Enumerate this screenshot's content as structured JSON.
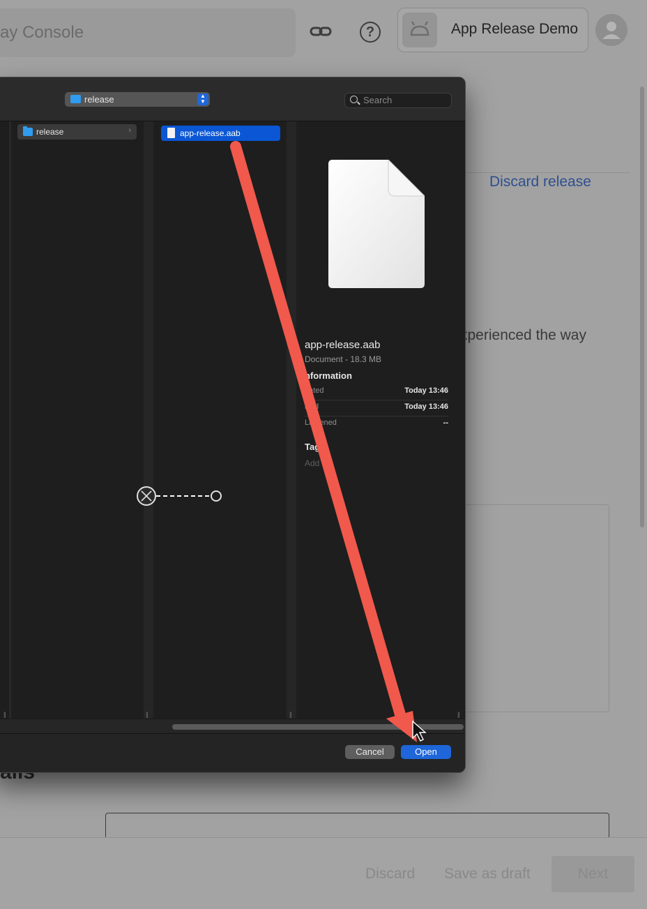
{
  "header": {
    "console_title": "ay Console",
    "app_name": "App Release Demo"
  },
  "page": {
    "discard_release": "Discard release",
    "experience_text": "xperienced the way",
    "details_heading": "ails"
  },
  "bottom_bar": {
    "discard": "Discard",
    "save_draft": "Save as draft",
    "next": "Next"
  },
  "dialog": {
    "path_folder": "release",
    "search_placeholder": "Search",
    "column1_item": "release",
    "column2_item": "app-release.aab",
    "preview": {
      "name": "app-release.aab",
      "kind": "Document - 18.3 MB",
      "information_heading": "nformation",
      "rows": [
        {
          "key": "eated",
          "value": "Today 13:46"
        },
        {
          "key": "ified",
          "value": "Today 13:46"
        },
        {
          "key": "La  pened",
          "value": "--"
        }
      ],
      "tags_heading": "Tag",
      "add_tags": "Add  s..."
    },
    "cancel_label": "Cancel",
    "open_label": "Open"
  },
  "colors": {
    "accent_blue": "#1e66d9",
    "selection_blue": "#0a56d4",
    "arrow_red": "#f0594c",
    "folder_blue": "#2f9cf0"
  }
}
